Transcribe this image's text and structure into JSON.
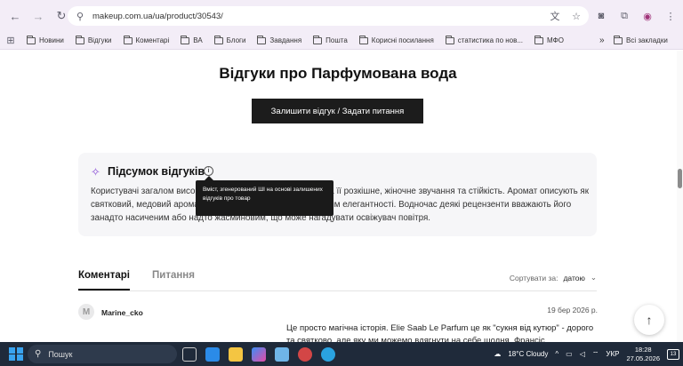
{
  "browser": {
    "url": "makeup.com.ua/ua/product/30543/",
    "bookmarks": [
      {
        "label": "Новини",
        "icon": "folder-icon"
      },
      {
        "label": "Відгуки",
        "icon": "folder-icon"
      },
      {
        "label": "Коментарі",
        "icon": "folder-icon"
      },
      {
        "label": "ВА",
        "icon": "folder-icon"
      },
      {
        "label": "Блоги",
        "icon": "folder-icon"
      },
      {
        "label": "Завдання",
        "icon": "folder-icon"
      },
      {
        "label": "Пошта",
        "icon": "folder-icon"
      },
      {
        "label": "Корисні посилання",
        "icon": "folder-icon"
      },
      {
        "label": "статистика по нов...",
        "icon": "folder-icon"
      },
      {
        "label": "МФО",
        "icon": "folder-icon"
      }
    ],
    "all_bookmarks": "Всі закладки"
  },
  "page": {
    "title": "Відгуки про Парфумована вода",
    "cta_label": "Залишити відгук / Задати питання",
    "summary": {
      "title": "Підсумок відгуків",
      "text": "Користувачі загалом високо оцінюють парфумовану воду за її розкішне, жіночне звучання та стійкість. Аромат описують як святковий, медовий аромат з квітковим жасмином і відчуттям елегантності. Водночас деякі рецензенти вважають його занадто насиченим або надто жасминовим, що може нагадувати освіжувач повітря.",
      "tooltip": "Вміст, згенерований ШІ на основі залишених відгуків про товар"
    },
    "tabs": [
      "Коментарі",
      "Питання"
    ],
    "sort_label": "Сортувати за:",
    "sort_value": "датою",
    "comment": {
      "avatar_letter": "M",
      "author": "Marine_cko",
      "date": "19 бер 2026 р.",
      "text": "Це просто магічна історія. Elie Saab Le Parfum це як \"сукня від кутюр\" - дорого та святково, але яку ми можемо вдягнути на себе щодня. Франсіс"
    }
  },
  "taskbar": {
    "search_placeholder": "Пошук",
    "weather": "18°C Cloudy",
    "language": "УКР",
    "time": "18:28",
    "date": "27.05.2026",
    "notifications": "13"
  },
  "colors": {
    "accent_purple": "#8a4fd6",
    "cta_bg": "#1c1c1c",
    "browser_bg": "#f3edf7",
    "taskbar_bg": "#1f2a3a"
  }
}
